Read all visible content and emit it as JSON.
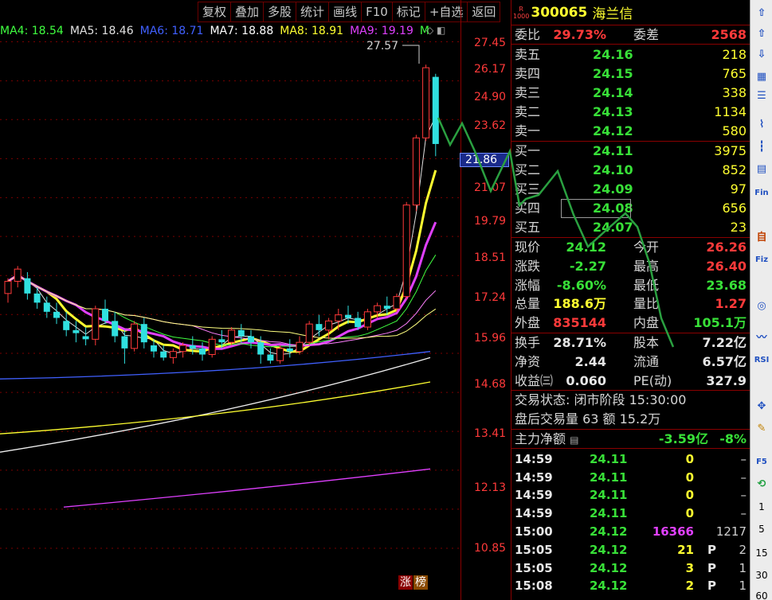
{
  "toolbar": {
    "buttons": [
      "复权",
      "叠加",
      "多股",
      "统计",
      "画线",
      "F10",
      "标记",
      "+自选",
      "返回"
    ]
  },
  "ma_legend": [
    {
      "label": "MA4: 18.54",
      "color": "#40ff40"
    },
    {
      "label": "MA5: 18.46",
      "color": "#e0e0e0"
    },
    {
      "label": "MA6: 18.71",
      "color": "#4060ff"
    },
    {
      "label": "MA7: 18.88",
      "color": "#ffffff"
    },
    {
      "label": "MA8: 18.91",
      "color": "#ffff30"
    },
    {
      "label": "MA9: 19.19",
      "color": "#e040ff"
    },
    {
      "label": "M",
      "color": "#40ff40"
    }
  ],
  "chart": {
    "peak_label": "27.57",
    "current_price_tag": "21.86",
    "price_axis": [
      "27.45",
      "26.17",
      "24.90",
      "23.62",
      "21.07",
      "19.79",
      "18.51",
      "17.24",
      "15.96",
      "14.68",
      "13.41",
      "12.13",
      "10.85"
    ],
    "badges": [
      "涨",
      "榜"
    ],
    "candles": [
      {
        "o": 19.2,
        "h": 19.7,
        "l": 18.9,
        "c": 19.6
      },
      {
        "o": 19.6,
        "h": 20.1,
        "l": 19.4,
        "c": 20.0
      },
      {
        "o": 19.7,
        "h": 19.9,
        "l": 19.0,
        "c": 19.2
      },
      {
        "o": 19.2,
        "h": 19.4,
        "l": 18.7,
        "c": 18.9
      },
      {
        "o": 18.9,
        "h": 19.1,
        "l": 18.4,
        "c": 18.6
      },
      {
        "o": 18.6,
        "h": 18.9,
        "l": 18.2,
        "c": 18.4
      },
      {
        "o": 18.3,
        "h": 18.6,
        "l": 17.8,
        "c": 18.0
      },
      {
        "o": 18.0,
        "h": 18.3,
        "l": 17.6,
        "c": 17.9
      },
      {
        "o": 17.8,
        "h": 18.1,
        "l": 17.5,
        "c": 17.7
      },
      {
        "o": 17.7,
        "h": 18.8,
        "l": 17.5,
        "c": 18.7
      },
      {
        "o": 18.7,
        "h": 19.0,
        "l": 18.2,
        "c": 18.3
      },
      {
        "o": 18.3,
        "h": 18.6,
        "l": 17.6,
        "c": 17.8
      },
      {
        "o": 17.8,
        "h": 18.0,
        "l": 16.9,
        "c": 17.4
      },
      {
        "o": 17.4,
        "h": 18.3,
        "l": 17.3,
        "c": 18.2
      },
      {
        "o": 18.2,
        "h": 18.4,
        "l": 17.4,
        "c": 17.6
      },
      {
        "o": 17.5,
        "h": 17.7,
        "l": 17.1,
        "c": 17.3
      },
      {
        "o": 17.3,
        "h": 17.5,
        "l": 17.0,
        "c": 17.1
      },
      {
        "o": 17.1,
        "h": 17.4,
        "l": 16.9,
        "c": 17.3
      },
      {
        "o": 17.3,
        "h": 17.6,
        "l": 17.1,
        "c": 17.5
      },
      {
        "o": 17.5,
        "h": 17.8,
        "l": 17.2,
        "c": 17.4
      },
      {
        "o": 17.4,
        "h": 17.6,
        "l": 17.0,
        "c": 17.2
      },
      {
        "o": 17.2,
        "h": 17.8,
        "l": 17.1,
        "c": 17.7
      },
      {
        "o": 17.7,
        "h": 18.0,
        "l": 17.4,
        "c": 17.6
      },
      {
        "o": 17.6,
        "h": 18.1,
        "l": 17.5,
        "c": 18.0
      },
      {
        "o": 18.0,
        "h": 18.2,
        "l": 17.6,
        "c": 17.8
      },
      {
        "o": 17.8,
        "h": 18.0,
        "l": 17.4,
        "c": 17.6
      },
      {
        "o": 17.6,
        "h": 17.8,
        "l": 16.9,
        "c": 17.2
      },
      {
        "o": 17.2,
        "h": 17.4,
        "l": 16.9,
        "c": 17.0
      },
      {
        "o": 17.0,
        "h": 17.5,
        "l": 16.9,
        "c": 17.4
      },
      {
        "o": 17.4,
        "h": 17.7,
        "l": 17.1,
        "c": 17.3
      },
      {
        "o": 17.3,
        "h": 17.8,
        "l": 17.2,
        "c": 17.6
      },
      {
        "o": 17.6,
        "h": 18.3,
        "l": 17.5,
        "c": 18.2
      },
      {
        "o": 18.2,
        "h": 18.5,
        "l": 17.8,
        "c": 18.0
      },
      {
        "o": 18.0,
        "h": 18.4,
        "l": 17.7,
        "c": 18.3
      },
      {
        "o": 18.3,
        "h": 18.7,
        "l": 18.0,
        "c": 18.5
      },
      {
        "o": 18.5,
        "h": 18.8,
        "l": 18.2,
        "c": 18.4
      },
      {
        "o": 18.4,
        "h": 18.6,
        "l": 18.0,
        "c": 18.1
      },
      {
        "o": 18.1,
        "h": 18.7,
        "l": 18.0,
        "c": 18.6
      },
      {
        "o": 18.6,
        "h": 18.9,
        "l": 18.4,
        "c": 18.8
      },
      {
        "o": 18.8,
        "h": 19.1,
        "l": 18.5,
        "c": 18.7
      },
      {
        "o": 18.7,
        "h": 19.2,
        "l": 18.6,
        "c": 19.1
      },
      {
        "o": 19.1,
        "h": 22.2,
        "l": 19.0,
        "c": 22.1
      },
      {
        "o": 22.1,
        "h": 24.4,
        "l": 21.9,
        "c": 24.3
      },
      {
        "o": 24.3,
        "h": 26.7,
        "l": 24.2,
        "c": 26.6
      },
      {
        "o": 26.3,
        "h": 26.4,
        "l": 23.7,
        "c": 24.1
      }
    ]
  },
  "quote": {
    "r_badge": "R",
    "r_sub": "1000",
    "code": "300065",
    "name": "海兰信",
    "weibi_label": "委比",
    "weibi_value": "29.73%",
    "weicha_label": "委差",
    "weicha_value": "2568",
    "sell": [
      {
        "label": "卖五",
        "price": "24.16",
        "vol": "218"
      },
      {
        "label": "卖四",
        "price": "24.15",
        "vol": "765"
      },
      {
        "label": "卖三",
        "price": "24.14",
        "vol": "338"
      },
      {
        "label": "卖二",
        "price": "24.13",
        "vol": "1134"
      },
      {
        "label": "卖一",
        "price": "24.12",
        "vol": "580"
      }
    ],
    "buy": [
      {
        "label": "买一",
        "price": "24.11",
        "vol": "3975"
      },
      {
        "label": "买二",
        "price": "24.10",
        "vol": "852"
      },
      {
        "label": "买三",
        "price": "24.09",
        "vol": "97"
      },
      {
        "label": "买四",
        "price": "24.08",
        "vol": "656"
      },
      {
        "label": "买五",
        "price": "24.07",
        "vol": "23"
      }
    ],
    "stats": [
      {
        "l1": "现价",
        "v1": "24.12",
        "c1": "green",
        "l2": "今开",
        "v2": "26.26",
        "c2": "red"
      },
      {
        "l1": "涨跌",
        "v1": "-2.27",
        "c1": "green",
        "l2": "最高",
        "v2": "26.40",
        "c2": "red"
      },
      {
        "l1": "涨幅",
        "v1": "-8.60%",
        "c1": "green",
        "l2": "最低",
        "v2": "23.68",
        "c2": "green"
      },
      {
        "l1": "总量",
        "v1": "188.6万",
        "c1": "yellow",
        "l2": "量比",
        "v2": "1.27",
        "c2": "red"
      },
      {
        "l1": "外盘",
        "v1": "835144",
        "c1": "red",
        "l2": "内盘",
        "v2": "105.1万",
        "c2": "green"
      }
    ],
    "stats2": [
      {
        "l1": "换手",
        "v1": "28.71%",
        "c1": "white",
        "l2": "股本",
        "v2": "7.22亿",
        "c2": "white"
      },
      {
        "l1": "净资",
        "v1": "2.44",
        "c1": "white",
        "l2": "流通",
        "v2": "6.57亿",
        "c2": "white"
      },
      {
        "l1": "收益㈢",
        "v1": "0.060",
        "c1": "white",
        "l2": "PE(动)",
        "v2": "327.9",
        "c2": "white"
      }
    ],
    "trade_status": "交易状态: 闭市阶段 15:30:00",
    "after_hours": "盘后交易量 63 额 15.2万",
    "main_flow_label": "主力净额",
    "main_flow_value": "-3.59亿",
    "main_flow_pct": "-8%",
    "ticks": [
      {
        "time": "14:59",
        "price": "24.11",
        "vol": "0",
        "vcolor": "yellow",
        "flag": "",
        "n": "–"
      },
      {
        "time": "14:59",
        "price": "24.11",
        "vol": "0",
        "vcolor": "yellow",
        "flag": "",
        "n": "–"
      },
      {
        "time": "14:59",
        "price": "24.11",
        "vol": "0",
        "vcolor": "yellow",
        "flag": "",
        "n": "–"
      },
      {
        "time": "14:59",
        "price": "24.11",
        "vol": "0",
        "vcolor": "yellow",
        "flag": "",
        "n": "–"
      },
      {
        "time": "15:00",
        "price": "24.12",
        "vol": "16366",
        "vcolor": "magenta",
        "flag": "",
        "n": "1217"
      },
      {
        "time": "15:05",
        "price": "24.12",
        "vol": "21",
        "vcolor": "yellow",
        "flag": "P",
        "n": "2"
      },
      {
        "time": "15:05",
        "price": "24.12",
        "vol": "3",
        "vcolor": "yellow",
        "flag": "P",
        "n": "1"
      },
      {
        "time": "15:08",
        "price": "24.12",
        "vol": "2",
        "vcolor": "yellow",
        "flag": "P",
        "n": "1"
      }
    ]
  },
  "icon_strip": {
    "icons": [
      "arrow-up-icon",
      "arrow-up-icon",
      "arrow-down-icon",
      "table-icon",
      "list-icon",
      "line-chart-icon",
      "candle-icon",
      "menu-icon",
      "f10-icon",
      "self-icon",
      "self-icon",
      "f10-icon",
      "circle-icon",
      "wave-icon",
      "rsi-icon",
      "move-icon",
      "pen-icon",
      "f5-icon",
      "refresh-icon"
    ],
    "labels": {
      "rsi": "RSI",
      "fin": "Fin",
      "zi": "自",
      "fiz": "Fiz",
      "f5": "F5"
    },
    "numbers": [
      "1",
      "5",
      "15",
      "30",
      "60"
    ]
  }
}
